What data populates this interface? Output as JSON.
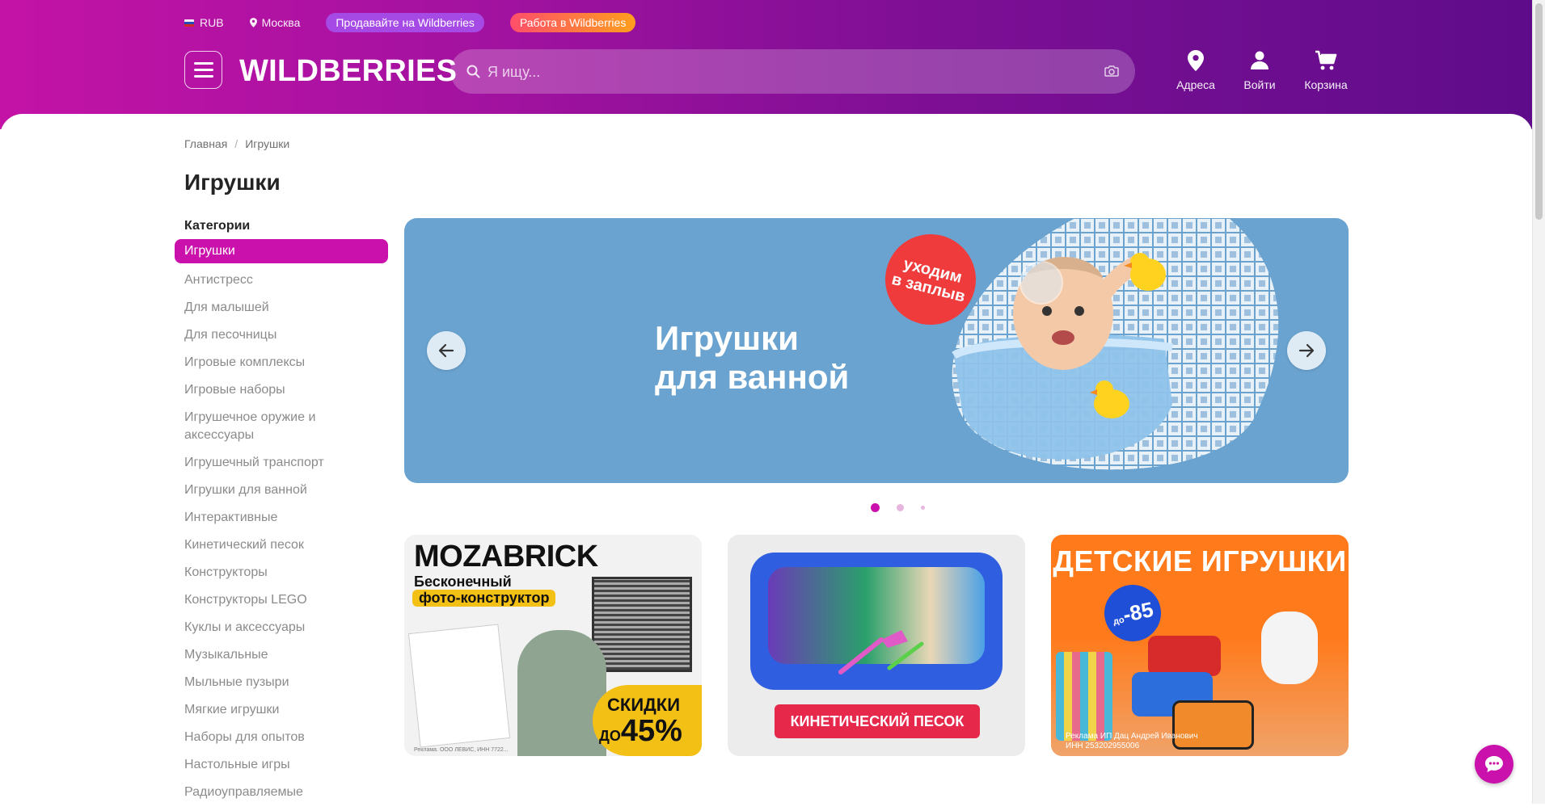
{
  "header": {
    "currency": "RUB",
    "city": "Москва",
    "sell_link": "Продавайте на Wildberries",
    "work_link": "Работа в Wildberries",
    "logo": "WILDBERRIES",
    "search_placeholder": "Я ищу...",
    "actions": {
      "addresses": "Адреса",
      "login": "Войти",
      "cart": "Корзина"
    }
  },
  "breadcrumb": {
    "home": "Главная",
    "current": "Игрушки"
  },
  "page_title": "Игрушки",
  "categories": {
    "title": "Категории",
    "items": [
      "Игрушки",
      "Антистресс",
      "Для малышей",
      "Для песочницы",
      "Игровые комплексы",
      "Игровые наборы",
      "Игрушечное оружие и аксессуары",
      "Игрушечный транспорт",
      "Игрушки для ванной",
      "Интерактивные",
      "Кинетический песок",
      "Конструкторы",
      "Конструкторы LEGO",
      "Куклы и аксессуары",
      "Музыкальные",
      "Мыльные пузыри",
      "Мягкие игрушки",
      "Наборы для опытов",
      "Настольные игры",
      "Радиоуправляемые"
    ],
    "active_index": 0
  },
  "banner": {
    "title_line1": "Игрушки",
    "title_line2": "для ванной",
    "badge_line1": "уходим",
    "badge_line2": "в заплыв",
    "slide_count": 3,
    "active_slide": 0
  },
  "promos": {
    "mozabrick": {
      "brand": "MOZABRICK",
      "line1": "Бесконечный",
      "line2": "фото-конструктор",
      "sale_line1": "СКИДКИ",
      "sale_prefix": "ДО",
      "sale_value": "45%",
      "note": "Реклама. ООО ЛЕВИС, ИНН 7722..."
    },
    "kinetic": {
      "cta": "КИНЕТИЧЕСКИЙ ПЕСОК"
    },
    "kids": {
      "title": "ДЕТСКИЕ ИГРУШКИ",
      "discount_prefix": "до",
      "discount": "-85",
      "ad_line1": "Реклама ИП Дац Андрей Иванович",
      "ad_line2": "ИНН 253202955006"
    }
  },
  "colors": {
    "accent": "#cb11ab",
    "header_start": "#c313a6",
    "header_end": "#5e0c8a",
    "banner_bg": "#6aa3cf",
    "text_muted": "#8b8b8b"
  },
  "icons": {
    "location": "location-pin-icon",
    "search": "search-icon",
    "camera": "camera-icon",
    "user": "user-icon",
    "cart": "cart-icon",
    "chat": "chat-icon",
    "arrow_left": "arrow-left-icon",
    "arrow_right": "arrow-right-icon"
  }
}
